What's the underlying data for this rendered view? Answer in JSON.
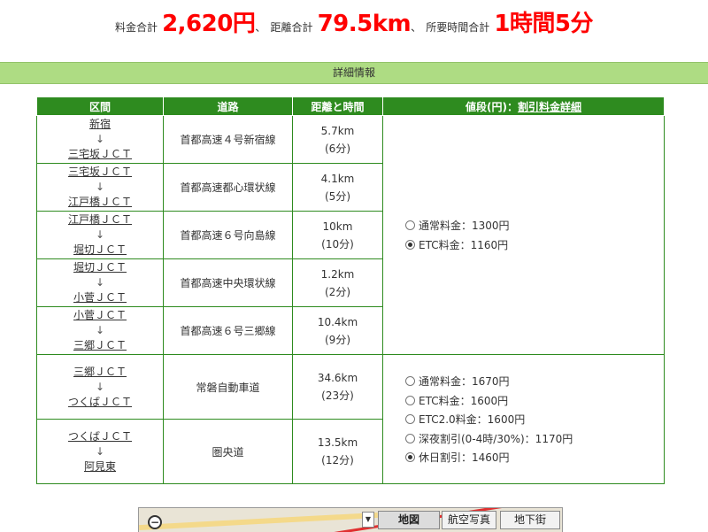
{
  "summary": {
    "fee_label": "料金合計",
    "fee_value": "2,620円",
    "sep1": "、",
    "distance_label": "距離合計",
    "distance_value": "79.5km",
    "sep2": "、",
    "time_label": "所要時間合計",
    "time_value": "1時間5分"
  },
  "detail_bar": {
    "label": "詳細情報"
  },
  "table": {
    "headers": {
      "section": "区間",
      "road": "道路",
      "distance_time": "距離と時間",
      "price_prefix": "値段(円)：",
      "price_link": "割引料金詳細"
    },
    "arrow": "↓",
    "rows": [
      {
        "from": "新宿",
        "to": "三宅坂ＪＣＴ",
        "road": "首都高速４号新宿線",
        "distance": "5.7km",
        "time": "(6分)"
      },
      {
        "from": "三宅坂ＪＣＴ",
        "to": "江戸橋ＪＣＴ",
        "road": "首都高速都心環状線",
        "distance": "4.1km",
        "time": "(5分)"
      },
      {
        "from": "江戸橋ＪＣＴ",
        "to": "堀切ＪＣＴ",
        "road": "首都高速６号向島線",
        "distance": "10km",
        "time": "(10分)"
      },
      {
        "from": "堀切ＪＣＴ",
        "to": "小菅ＪＣＴ",
        "road": "首都高速中央環状線",
        "distance": "1.2km",
        "time": "(2分)"
      },
      {
        "from": "小菅ＪＣＴ",
        "to": "三郷ＪＣＴ",
        "road": "首都高速６号三郷線",
        "distance": "10.4km",
        "time": "(9分)"
      },
      {
        "from": "三郷ＪＣＴ",
        "to": "つくばＪＣＴ",
        "road": "常磐自動車道",
        "distance": "34.6km",
        "time": "(23分)"
      },
      {
        "from": "つくばＪＣＴ",
        "to": "阿見東",
        "road": "圏央道",
        "distance": "13.5km",
        "time": "(12分)"
      }
    ],
    "price_groups": [
      {
        "options": [
          {
            "label": "通常料金：1300円",
            "selected": false
          },
          {
            "label": "ETC料金：1160円",
            "selected": true
          }
        ]
      },
      {
        "options": [
          {
            "label": "通常料金：1670円",
            "selected": false
          },
          {
            "label": "ETC料金：1600円",
            "selected": false
          },
          {
            "label": "ETC2.0料金：1600円",
            "selected": false
          },
          {
            "label": "深夜割引(0-4時/30%)：1170円",
            "selected": false
          },
          {
            "label": "休日割引：1460円",
            "selected": true
          }
        ]
      }
    ]
  },
  "map": {
    "zoom_symbol": "−",
    "dropdown_symbol": "▼",
    "buttons": {
      "map": "地図",
      "aerial": "航空写真",
      "underground": "地下街"
    }
  }
}
